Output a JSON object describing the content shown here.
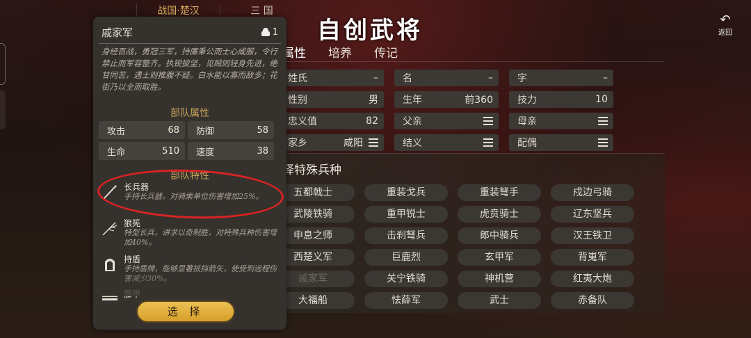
{
  "era_tabs": [
    "战国·楚汉",
    "三 国"
  ],
  "page_title": "自创武将",
  "back_label": "返回",
  "sub_tabs": [
    "属性",
    "培养",
    "传记"
  ],
  "attributes": [
    {
      "label": "姓氏",
      "value": "–",
      "menu": false
    },
    {
      "label": "名",
      "value": "–",
      "menu": false
    },
    {
      "label": "字",
      "value": "–",
      "menu": false
    },
    {
      "label": "性别",
      "value": "男",
      "menu": false
    },
    {
      "label": "生年",
      "value": "前360",
      "menu": false
    },
    {
      "label": "技力",
      "value": "10",
      "menu": false
    },
    {
      "label": "忠义值",
      "value": "82",
      "menu": false
    },
    {
      "label": "父亲",
      "value": "",
      "menu": true
    },
    {
      "label": "母亲",
      "value": "",
      "menu": true
    },
    {
      "label": "家乡",
      "value": "咸阳",
      "menu": true
    },
    {
      "label": "结义",
      "value": "",
      "menu": true
    },
    {
      "label": "配偶",
      "value": "",
      "menu": true
    }
  ],
  "special_title": "择特殊兵种",
  "troops": [
    "五都戟士",
    "重装戈兵",
    "重装弩手",
    "戍边弓骑",
    "武陵铁骑",
    "重甲锐士",
    "虎贲骑士",
    "辽东坚兵",
    "申息之师",
    "击刹弩兵",
    "郎中骑兵",
    "汉王铁卫",
    "西楚义军",
    "巨鹿烈",
    "玄甲军",
    "背嵬军",
    "戚家军",
    "关宁铁骑",
    "神机营",
    "红夷大炮",
    "大福船",
    "怯薛军",
    "武士",
    "赤备队"
  ],
  "selected_troop": "戚家军",
  "panel": {
    "title": "戚家军",
    "count": "1",
    "description": "身经百战，勇冠三军，持廉秉公而士心咸服，令行禁止而军容整齐。执锐披坚，见贼则轻身先进，绝甘同苦，遇士则推腹不疑。白水能以寡而敌多；花街乃以全而取胜。",
    "section_attributes": "部队属性",
    "stats": [
      {
        "label": "攻击",
        "value": "68"
      },
      {
        "label": "防御",
        "value": "58"
      },
      {
        "label": "生命",
        "value": "510"
      },
      {
        "label": "速度",
        "value": "38"
      }
    ],
    "section_traits": "部队特性",
    "traits": [
      {
        "icon": "spear-icon",
        "name": "长兵器",
        "desc": "手持长兵器，对骑乘单位伤害增加25%。"
      },
      {
        "icon": "wolf-brush-icon",
        "name": "狼筅",
        "desc": "特型长兵，讲求以奇制胜，对特殊兵种伤害增加40%。"
      },
      {
        "icon": "shield-icon",
        "name": "持盾",
        "desc": "手持盾牌，能够显著抵挡箭矢，使受到远程伤害减少30%。"
      },
      {
        "icon": "rattan-armor-icon",
        "name": "藤甲",
        "desc": ""
      }
    ],
    "select_label": "选 择"
  },
  "colors": {
    "accent": "#d8b061",
    "button": "#e2b040",
    "highlight": "#d72424"
  }
}
